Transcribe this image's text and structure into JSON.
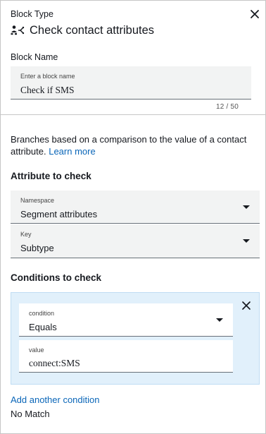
{
  "header": {
    "block_type_label": "Block Type",
    "block_type_title": "Check contact attributes",
    "block_type_icon": "branch-icon",
    "close_icon": "close-icon"
  },
  "block_name": {
    "label": "Block Name",
    "field_label": "Enter a block name",
    "value": "Check if SMS",
    "char_count": "12 / 50"
  },
  "description": {
    "text": "Branches based on a comparison to the value of a contact attribute.",
    "link_text": "Learn more"
  },
  "attribute_section": {
    "title": "Attribute to check",
    "namespace": {
      "label": "Namespace",
      "value": "Segment attributes"
    },
    "key": {
      "label": "Key",
      "value": "Subtype"
    }
  },
  "conditions_section": {
    "title": "Conditions to check",
    "conditions": [
      {
        "condition_label": "condition",
        "condition_value": "Equals",
        "value_label": "value",
        "value": "connect:SMS"
      }
    ],
    "add_condition_label": "Add another condition"
  },
  "no_match_label": "No Match",
  "colors": {
    "link": "#0a66b8",
    "field_bg": "#f2f3f3",
    "condition_bg": "#e1f0fb"
  }
}
